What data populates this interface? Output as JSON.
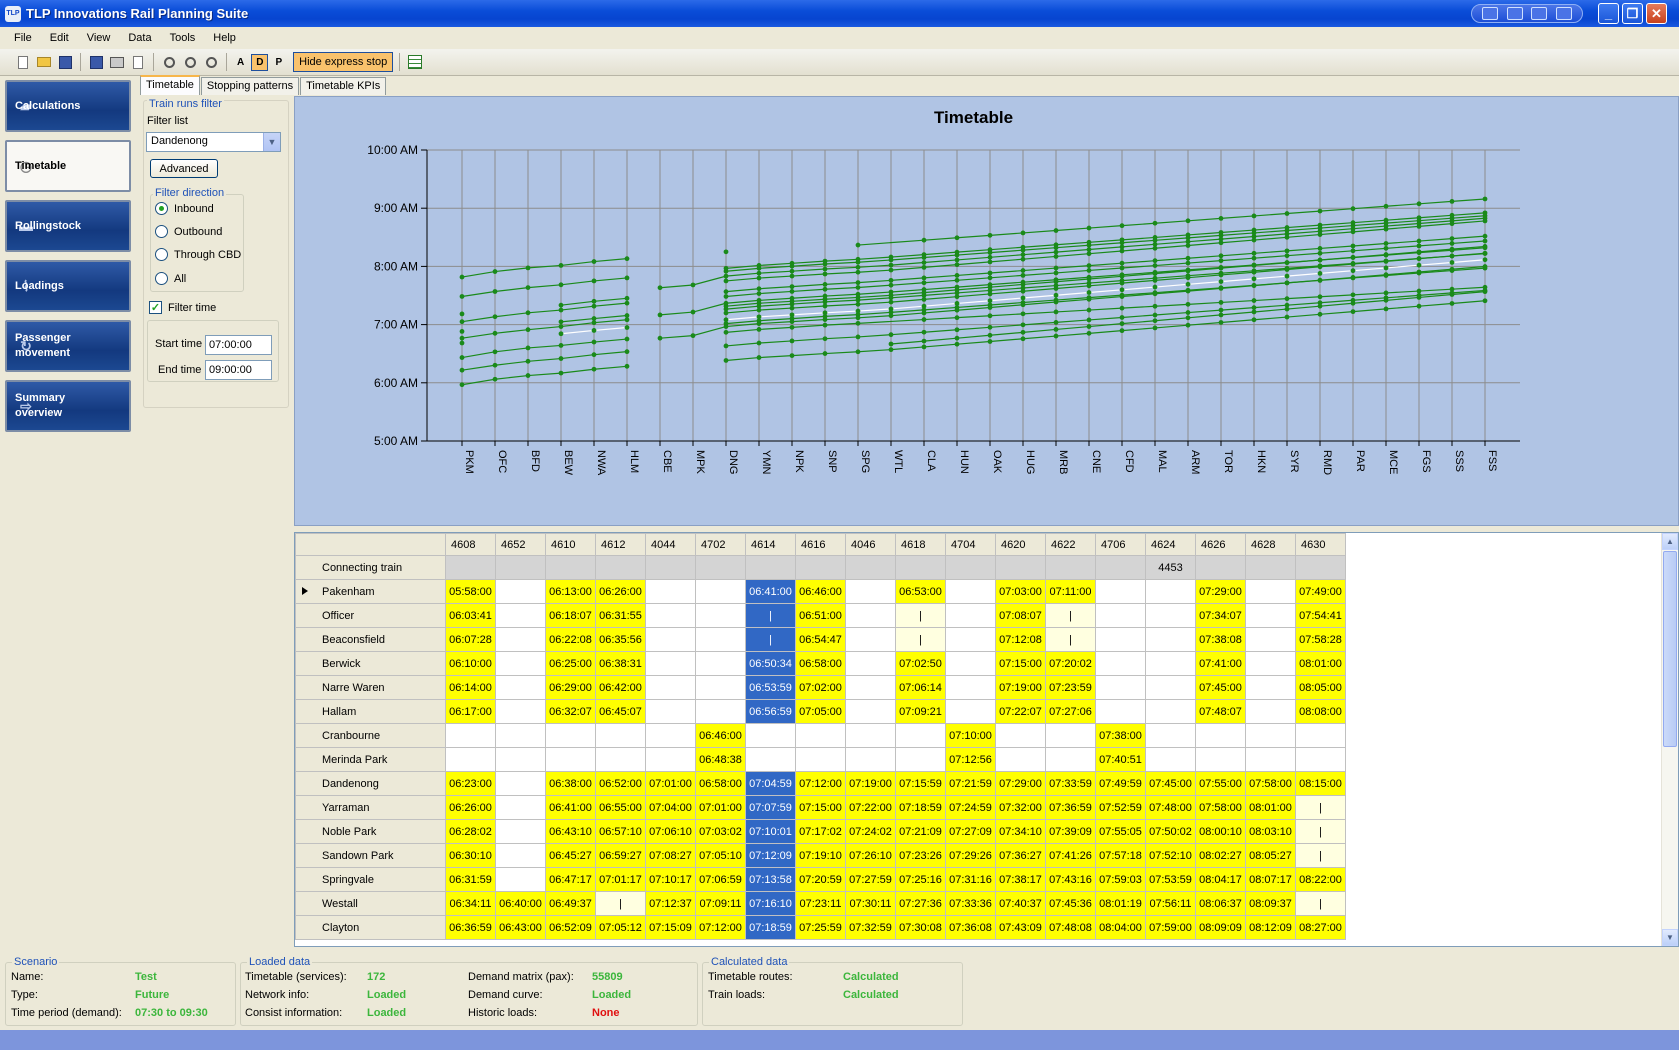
{
  "window": {
    "title": "TLP Innovations Rail Planning Suite",
    "icon_text": "TLP"
  },
  "menu": [
    "File",
    "Edit",
    "View",
    "Data",
    "Tools",
    "Help"
  ],
  "toolbar": {
    "a_label": "A",
    "d_label": "D",
    "p_label": "P",
    "hide_express_label": "Hide express stop"
  },
  "sidebar": {
    "items": [
      {
        "label": "Calculations",
        "icon": "train-icon",
        "active": false
      },
      {
        "label": "Timetable",
        "icon": "clock-icon",
        "active": true
      },
      {
        "label": "Rollingstock",
        "icon": "locomotive-icon",
        "active": false
      },
      {
        "label": "Loadings",
        "icon": "chart-icon",
        "active": false
      },
      {
        "label": "Passenger movement",
        "icon": "cycle-icon",
        "active": false
      },
      {
        "label": "Summary overview",
        "icon": "arrow-icon",
        "active": false
      }
    ]
  },
  "tabs": [
    "Timetable",
    "Stopping patterns",
    "Timetable KPIs"
  ],
  "filter": {
    "group_title": "Train runs filter",
    "filter_list_label": "Filter list",
    "filter_list_value": "Dandenong",
    "advanced_label": "Advanced",
    "direction_title": "Filter direction",
    "directions": [
      "Inbound",
      "Outbound",
      "Through CBD",
      "All"
    ],
    "selected_direction": "Inbound",
    "filter_time_label": "Filter time",
    "filter_time_checked": true,
    "start_label": "Start time",
    "start_value": "07:00:00",
    "end_label": "End time",
    "end_value": "09:00:00"
  },
  "chart_data": {
    "type": "line",
    "title": "Timetable",
    "categories": [
      "PKM",
      "OFC",
      "BFD",
      "BEW",
      "NWA",
      "HLM",
      "CBE",
      "MPK",
      "DNG",
      "YMN",
      "NPK",
      "SNP",
      "SPG",
      "WTL",
      "CLA",
      "HUN",
      "OAK",
      "HUG",
      "MRB",
      "CNE",
      "CFD",
      "MAL",
      "ARM",
      "TOR",
      "HKN",
      "SYR",
      "RMD",
      "PAR",
      "MCE",
      "FGS",
      "SSS",
      "FSS"
    ],
    "y_ticks": [
      "10:00 AM",
      "9:00 AM",
      "8:00 AM",
      "7:00 AM",
      "6:00 AM",
      "5:00 AM"
    ],
    "ylim_hours": [
      5,
      10
    ],
    "grid": true,
    "legend": "none",
    "line_color": "#1a8a1a",
    "highlight_color": "#ffffff"
  },
  "grid": {
    "trains": [
      "4608",
      "4652",
      "4610",
      "4612",
      "4044",
      "4702",
      "4614",
      "4616",
      "4046",
      "4618",
      "4704",
      "4620",
      "4622",
      "4706",
      "4624",
      "4626",
      "4628",
      "4630"
    ],
    "connecting_label": "Connecting train",
    "connecting": [
      "",
      "",
      "",
      "",
      "",
      "",
      "",
      "",
      "",
      "",
      "",
      "",
      "",
      "",
      "4453",
      "",
      "",
      ""
    ],
    "current_row": "Pakenham",
    "selected_col": "4614",
    "rows": [
      {
        "station": "Pakenham",
        "times": [
          "05:58:00",
          "",
          "06:13:00",
          "06:26:00",
          "",
          "",
          "06:41:00",
          "06:46:00",
          "",
          "06:53:00",
          "",
          "07:03:00",
          "07:11:00",
          "",
          "",
          "07:29:00",
          "",
          "07:49:00"
        ]
      },
      {
        "station": "Officer",
        "times": [
          "06:03:41",
          "",
          "06:18:07",
          "06:31:55",
          "",
          "",
          "|",
          "06:51:00",
          "",
          "|",
          "",
          "07:08:07",
          "|",
          "",
          "",
          "07:34:07",
          "",
          "07:54:41"
        ]
      },
      {
        "station": "Beaconsfield",
        "times": [
          "06:07:28",
          "",
          "06:22:08",
          "06:35:56",
          "",
          "",
          "|",
          "06:54:47",
          "",
          "|",
          "",
          "07:12:08",
          "|",
          "",
          "",
          "07:38:08",
          "",
          "07:58:28"
        ]
      },
      {
        "station": "Berwick",
        "times": [
          "06:10:00",
          "",
          "06:25:00",
          "06:38:31",
          "",
          "",
          "06:50:34",
          "06:58:00",
          "",
          "07:02:50",
          "",
          "07:15:00",
          "07:20:02",
          "",
          "",
          "07:41:00",
          "",
          "08:01:00"
        ]
      },
      {
        "station": "Narre Waren",
        "times": [
          "06:14:00",
          "",
          "06:29:00",
          "06:42:00",
          "",
          "",
          "06:53:59",
          "07:02:00",
          "",
          "07:06:14",
          "",
          "07:19:00",
          "07:23:59",
          "",
          "",
          "07:45:00",
          "",
          "08:05:00"
        ]
      },
      {
        "station": "Hallam",
        "times": [
          "06:17:00",
          "",
          "06:32:07",
          "06:45:07",
          "",
          "",
          "06:56:59",
          "07:05:00",
          "",
          "07:09:21",
          "",
          "07:22:07",
          "07:27:06",
          "",
          "",
          "07:48:07",
          "",
          "08:08:00"
        ]
      },
      {
        "station": "Cranbourne",
        "times": [
          "",
          "",
          "",
          "",
          "",
          "06:46:00",
          "",
          "",
          "",
          "",
          "07:10:00",
          "",
          "",
          "07:38:00",
          "",
          "",
          "",
          ""
        ]
      },
      {
        "station": "Merinda Park",
        "times": [
          "",
          "",
          "",
          "",
          "",
          "06:48:38",
          "",
          "",
          "",
          "",
          "07:12:56",
          "",
          "",
          "07:40:51",
          "",
          "",
          "",
          ""
        ]
      },
      {
        "station": "Dandenong",
        "times": [
          "06:23:00",
          "",
          "06:38:00",
          "06:52:00",
          "07:01:00",
          "06:58:00",
          "07:04:59",
          "07:12:00",
          "07:19:00",
          "07:15:59",
          "07:21:59",
          "07:29:00",
          "07:33:59",
          "07:49:59",
          "07:45:00",
          "07:55:00",
          "07:58:00",
          "08:15:00"
        ]
      },
      {
        "station": "Yarraman",
        "times": [
          "06:26:00",
          "",
          "06:41:00",
          "06:55:00",
          "07:04:00",
          "07:01:00",
          "07:07:59",
          "07:15:00",
          "07:22:00",
          "07:18:59",
          "07:24:59",
          "07:32:00",
          "07:36:59",
          "07:52:59",
          "07:48:00",
          "07:58:00",
          "08:01:00",
          "|"
        ]
      },
      {
        "station": "Noble Park",
        "times": [
          "06:28:02",
          "",
          "06:43:10",
          "06:57:10",
          "07:06:10",
          "07:03:02",
          "07:10:01",
          "07:17:02",
          "07:24:02",
          "07:21:09",
          "07:27:09",
          "07:34:10",
          "07:39:09",
          "07:55:05",
          "07:50:02",
          "08:00:10",
          "08:03:10",
          "|"
        ]
      },
      {
        "station": "Sandown Park",
        "times": [
          "06:30:10",
          "",
          "06:45:27",
          "06:59:27",
          "07:08:27",
          "07:05:10",
          "07:12:09",
          "07:19:10",
          "07:26:10",
          "07:23:26",
          "07:29:26",
          "07:36:27",
          "07:41:26",
          "07:57:18",
          "07:52:10",
          "08:02:27",
          "08:05:27",
          "|"
        ]
      },
      {
        "station": "Springvale",
        "times": [
          "06:31:59",
          "",
          "06:47:17",
          "07:01:17",
          "07:10:17",
          "07:06:59",
          "07:13:58",
          "07:20:59",
          "07:27:59",
          "07:25:16",
          "07:31:16",
          "07:38:17",
          "07:43:16",
          "07:59:03",
          "07:53:59",
          "08:04:17",
          "08:07:17",
          "08:22:00"
        ]
      },
      {
        "station": "Westall",
        "times": [
          "06:34:11",
          "06:40:00",
          "06:49:37",
          "|",
          "07:12:37",
          "07:09:11",
          "07:16:10",
          "07:23:11",
          "07:30:11",
          "07:27:36",
          "07:33:36",
          "07:40:37",
          "07:45:36",
          "08:01:19",
          "07:56:11",
          "08:06:37",
          "08:09:37",
          "|"
        ]
      },
      {
        "station": "Clayton",
        "times": [
          "06:36:59",
          "06:43:00",
          "06:52:09",
          "07:05:12",
          "07:15:09",
          "07:12:00",
          "07:18:59",
          "07:25:59",
          "07:32:59",
          "07:30:08",
          "07:36:08",
          "07:43:09",
          "07:48:08",
          "08:04:00",
          "07:59:00",
          "08:09:09",
          "08:12:09",
          "08:27:00"
        ]
      }
    ]
  },
  "status": {
    "scenario": {
      "title": "Scenario",
      "name_label": "Name:",
      "name_value": "Test",
      "type_label": "Type:",
      "type_value": "Future",
      "period_label": "Time period (demand):",
      "period_value": "07:30 to 09:30"
    },
    "loaded": {
      "title": "Loaded data",
      "timetable_label": "Timetable (services):",
      "timetable_value": "172",
      "network_label": "Network info:",
      "network_value": "Loaded",
      "consist_label": "Consist information:",
      "consist_value": "Loaded",
      "demand_matrix_label": "Demand matrix (pax):",
      "demand_matrix_value": "55809",
      "demand_curve_label": "Demand curve:",
      "demand_curve_value": "Loaded",
      "historic_label": "Historic loads:",
      "historic_value": "None"
    },
    "calculated": {
      "title": "Calculated data",
      "routes_label": "Timetable routes:",
      "routes_value": "Calculated",
      "loads_label": "Train loads:",
      "loads_value": "Calculated"
    }
  }
}
